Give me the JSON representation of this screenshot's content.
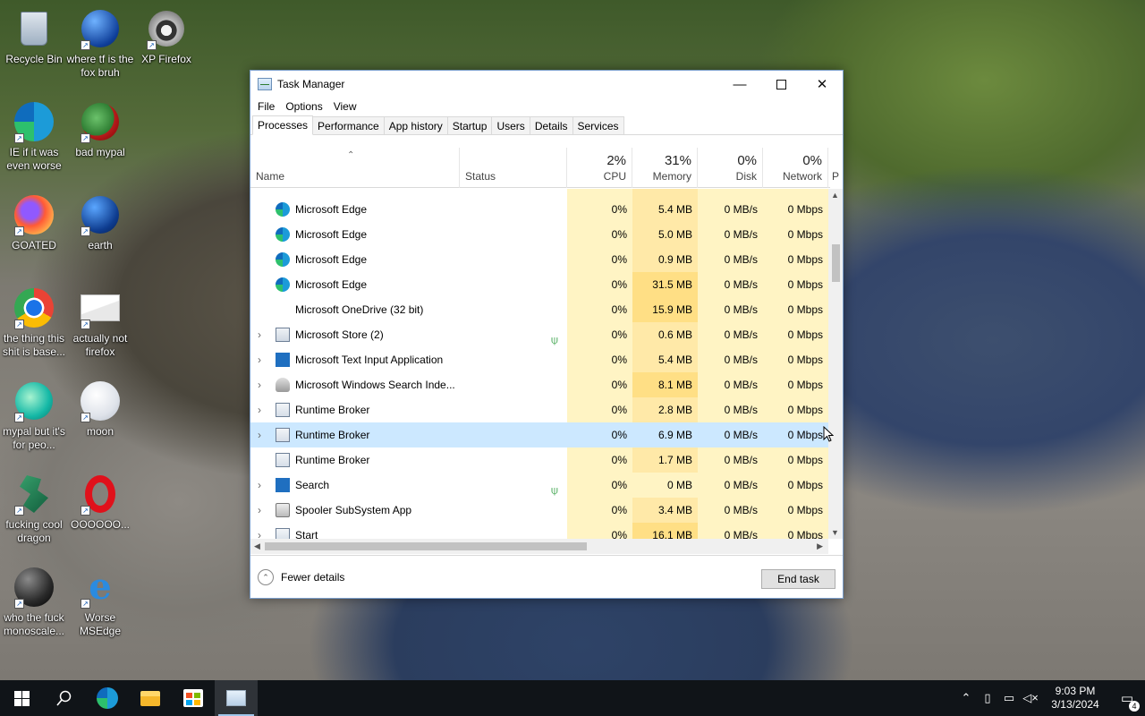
{
  "desktop": {
    "icons": [
      {
        "label": "Recycle Bin",
        "icon": "recycle-bin-icon"
      },
      {
        "label": "where tf is the fox bruh",
        "icon": "globe-icon"
      },
      {
        "label": "XP Firefox",
        "icon": "raccoon-icon"
      },
      {
        "label": "IE if it was even worse",
        "icon": "edge-icon"
      },
      {
        "label": "bad mypal",
        "icon": "mypal-icon"
      },
      {
        "label": "GOATED",
        "icon": "firefox-icon"
      },
      {
        "label": "earth",
        "icon": "globe-icon"
      },
      {
        "label": "the thing this shit is base...",
        "icon": "chrome-icon"
      },
      {
        "label": "actually not firefox",
        "icon": "envelope-icon"
      },
      {
        "label": "mypal but it's for peo...",
        "icon": "mypal-icon"
      },
      {
        "label": "moon",
        "icon": "moon-icon"
      },
      {
        "label": "fucking cool dragon",
        "icon": "dragon-icon"
      },
      {
        "label": "OOOOOO...",
        "icon": "opera-icon"
      },
      {
        "label": "who the fuck monoscale...",
        "icon": "dark-globe-icon"
      },
      {
        "label": "Worse MSEdge",
        "icon": "ie-icon"
      }
    ]
  },
  "window": {
    "title": "Task Manager",
    "menu": [
      "File",
      "Options",
      "View"
    ],
    "tabs": [
      "Processes",
      "Performance",
      "App history",
      "Startup",
      "Users",
      "Details",
      "Services"
    ],
    "active_tab": "Processes"
  },
  "columns": {
    "name": "Name",
    "status": "Status",
    "cpu": {
      "pct": "2%",
      "label": "CPU"
    },
    "memory": {
      "pct": "31%",
      "label": "Memory"
    },
    "disk": {
      "pct": "0%",
      "label": "Disk"
    },
    "network": {
      "pct": "0%",
      "label": "Network"
    },
    "power": "P"
  },
  "processes": [
    {
      "name": "Microsoft Edge",
      "icon": "edge-icon",
      "expand": false,
      "leaf": false,
      "cpu": "0%",
      "mem": "5.4 MB",
      "disk": "0 MB/s",
      "net": "0 Mbps",
      "selected": false
    },
    {
      "name": "Microsoft Edge",
      "icon": "edge-icon",
      "expand": false,
      "leaf": false,
      "cpu": "0%",
      "mem": "5.0 MB",
      "disk": "0 MB/s",
      "net": "0 Mbps",
      "selected": false
    },
    {
      "name": "Microsoft Edge",
      "icon": "edge-icon",
      "expand": false,
      "leaf": false,
      "cpu": "0%",
      "mem": "0.9 MB",
      "disk": "0 MB/s",
      "net": "0 Mbps",
      "selected": false
    },
    {
      "name": "Microsoft Edge",
      "icon": "edge-icon",
      "expand": false,
      "leaf": false,
      "cpu": "0%",
      "mem": "31.5 MB",
      "disk": "0 MB/s",
      "net": "0 Mbps",
      "selected": false
    },
    {
      "name": "Microsoft OneDrive (32 bit)",
      "icon": "",
      "expand": false,
      "leaf": false,
      "cpu": "0%",
      "mem": "15.9 MB",
      "disk": "0 MB/s",
      "net": "0 Mbps",
      "selected": false
    },
    {
      "name": "Microsoft Store (2)",
      "icon": "store-icon",
      "expand": true,
      "leaf": true,
      "cpu": "0%",
      "mem": "0.6 MB",
      "disk": "0 MB/s",
      "net": "0 Mbps",
      "selected": false
    },
    {
      "name": "Microsoft Text Input Application",
      "icon": "blue-window-icon",
      "expand": true,
      "leaf": false,
      "cpu": "0%",
      "mem": "5.4 MB",
      "disk": "0 MB/s",
      "net": "0 Mbps",
      "selected": false
    },
    {
      "name": "Microsoft Windows Search Inde...",
      "icon": "search-indexer-icon",
      "expand": true,
      "leaf": false,
      "cpu": "0%",
      "mem": "8.1 MB",
      "disk": "0 MB/s",
      "net": "0 Mbps",
      "selected": false
    },
    {
      "name": "Runtime Broker",
      "icon": "window-icon",
      "expand": true,
      "leaf": false,
      "cpu": "0%",
      "mem": "2.8 MB",
      "disk": "0 MB/s",
      "net": "0 Mbps",
      "selected": false
    },
    {
      "name": "Runtime Broker",
      "icon": "window-icon",
      "expand": true,
      "leaf": false,
      "cpu": "0%",
      "mem": "6.9 MB",
      "disk": "0 MB/s",
      "net": "0 Mbps",
      "selected": true
    },
    {
      "name": "Runtime Broker",
      "icon": "window-icon",
      "expand": false,
      "leaf": false,
      "cpu": "0%",
      "mem": "1.7 MB",
      "disk": "0 MB/s",
      "net": "0 Mbps",
      "selected": false
    },
    {
      "name": "Search",
      "icon": "search-icon",
      "expand": true,
      "leaf": true,
      "cpu": "0%",
      "mem": "0 MB",
      "disk": "0 MB/s",
      "net": "0 Mbps",
      "selected": false
    },
    {
      "name": "Spooler SubSystem App",
      "icon": "printer-icon",
      "expand": true,
      "leaf": false,
      "cpu": "0%",
      "mem": "3.4 MB",
      "disk": "0 MB/s",
      "net": "0 Mbps",
      "selected": false
    },
    {
      "name": "Start",
      "icon": "start-icon",
      "expand": true,
      "leaf": false,
      "cpu": "0%",
      "mem": "16.1 MB",
      "disk": "0 MB/s",
      "net": "0 Mbps",
      "selected": false
    }
  ],
  "footer": {
    "fewer_details": "Fewer details",
    "end_task": "End task"
  },
  "taskbar": {
    "items": [
      "start-icon",
      "search-icon",
      "edge-icon",
      "file-explorer-icon",
      "store-icon",
      "task-manager-icon"
    ],
    "time": "9:03 PM",
    "date": "3/13/2024",
    "notifications": "4"
  }
}
